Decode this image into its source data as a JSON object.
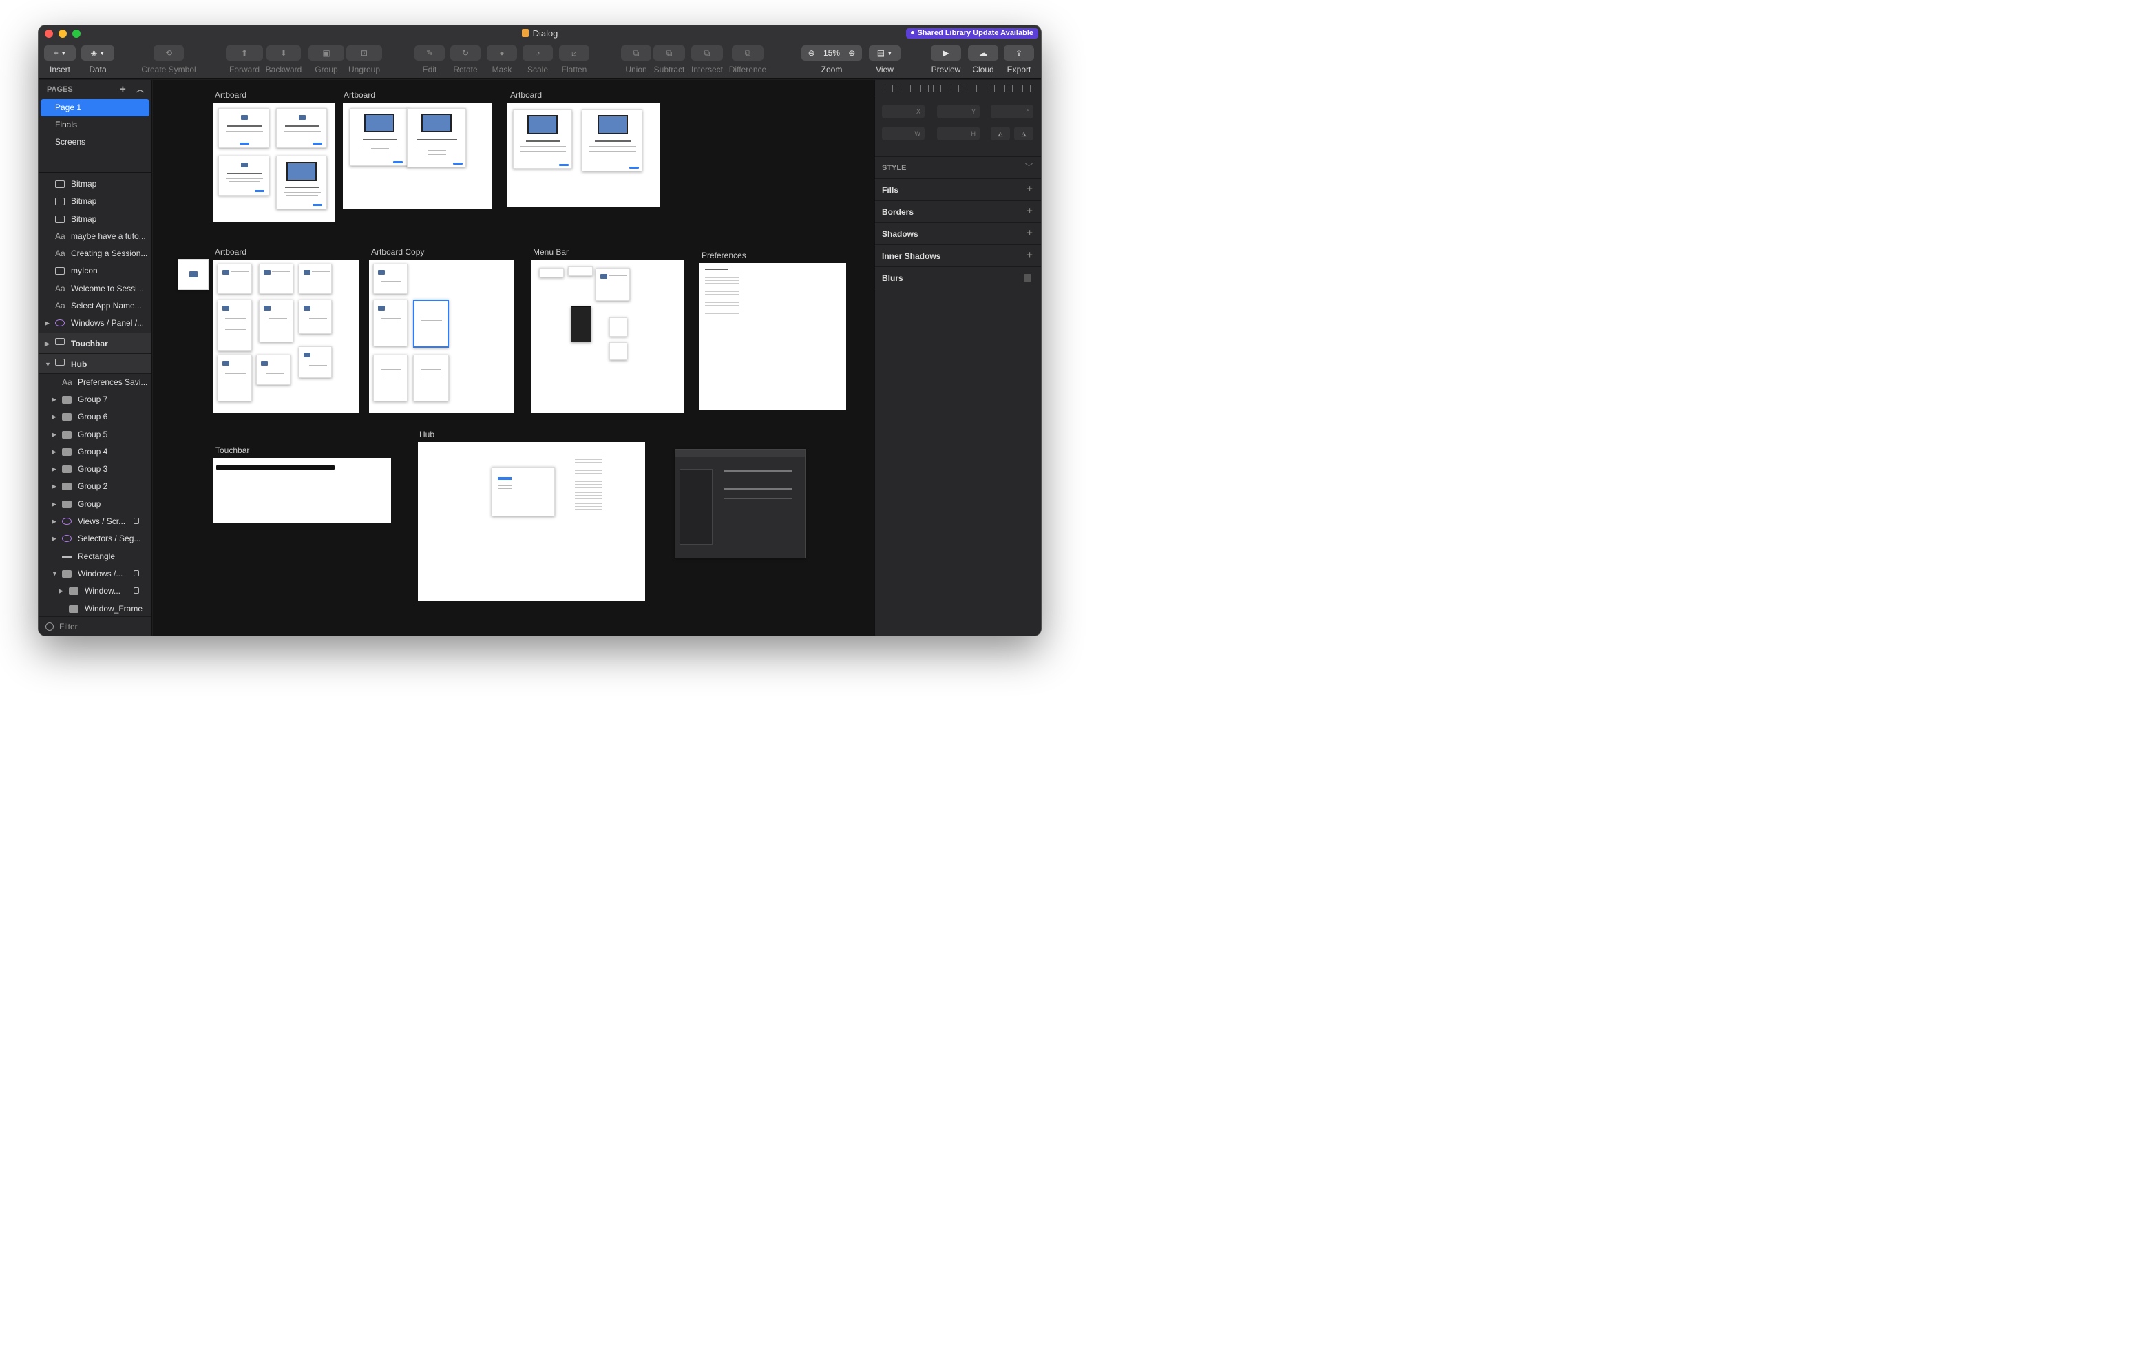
{
  "window": {
    "title": "Dialog",
    "notification": "Shared Library Update Available"
  },
  "toolbar": {
    "insert": "Insert",
    "data": "Data",
    "create_symbol": "Create Symbol",
    "forward": "Forward",
    "backward": "Backward",
    "group": "Group",
    "ungroup": "Ungroup",
    "edit": "Edit",
    "rotate": "Rotate",
    "mask": "Mask",
    "scale": "Scale",
    "flatten": "Flatten",
    "union": "Union",
    "subtract": "Subtract",
    "intersect": "Intersect",
    "difference": "Difference",
    "zoom_label": "Zoom",
    "zoom_value": "15%",
    "view": "View",
    "preview": "Preview",
    "cloud": "Cloud",
    "export": "Export"
  },
  "pages": {
    "header": "PAGES",
    "items": [
      "Page 1",
      "Finals",
      "Screens"
    ],
    "selected": "Page 1"
  },
  "layers": [
    {
      "label": "Bitmap",
      "icon": "image-icon",
      "level": 0
    },
    {
      "label": "Bitmap",
      "icon": "image-icon",
      "level": 0
    },
    {
      "label": "Bitmap",
      "icon": "image-icon",
      "level": 0
    },
    {
      "label": "maybe have a tuto...",
      "icon": "text-icon",
      "level": 0
    },
    {
      "label": "Creating a Session...",
      "icon": "text-icon",
      "level": 0
    },
    {
      "label": "myIcon",
      "icon": "image-icon",
      "level": 0
    },
    {
      "label": "Welcome to Sessi...",
      "icon": "text-icon",
      "level": 0
    },
    {
      "label": "Select App Name...",
      "icon": "text-icon",
      "level": 0
    },
    {
      "label": "Windows / Panel /...",
      "icon": "symbol-icon",
      "level": 0,
      "expandable": true
    }
  ],
  "artboard_groups": [
    {
      "label": "Touchbar",
      "expanded": false
    },
    {
      "label": "Hub",
      "expanded": true
    }
  ],
  "hub_layers": [
    {
      "label": "Preferences Savi...",
      "icon": "text-icon",
      "level": 1
    },
    {
      "label": "Group 7",
      "icon": "folder-icon",
      "level": 1,
      "expandable": true
    },
    {
      "label": "Group 6",
      "icon": "folder-icon",
      "level": 1,
      "expandable": true
    },
    {
      "label": "Group 5",
      "icon": "folder-icon",
      "level": 1,
      "expandable": true
    },
    {
      "label": "Group 4",
      "icon": "folder-icon",
      "level": 1,
      "expandable": true
    },
    {
      "label": "Group 3",
      "icon": "folder-icon",
      "level": 1,
      "expandable": true
    },
    {
      "label": "Group 2",
      "icon": "folder-icon",
      "level": 1,
      "expandable": true
    },
    {
      "label": "Group",
      "icon": "folder-icon",
      "level": 1,
      "expandable": true
    },
    {
      "label": "Views / Scr...",
      "icon": "symbol-icon",
      "level": 1,
      "expandable": true,
      "locked": true
    },
    {
      "label": "Selectors / Seg...",
      "icon": "symbol-icon",
      "level": 1,
      "expandable": true
    },
    {
      "label": "Rectangle",
      "icon": "rectangle-icon",
      "level": 1
    },
    {
      "label": "Windows /...",
      "icon": "folder-icon",
      "level": 1,
      "expandable": true,
      "expanded": true,
      "locked": true
    },
    {
      "label": "Window...",
      "icon": "folder-icon",
      "level": 2,
      "expandable": true,
      "locked": true
    },
    {
      "label": "Window_Frame",
      "icon": "folder-icon",
      "level": 2
    }
  ],
  "filter": {
    "placeholder": "Filter"
  },
  "canvas": {
    "artboards": [
      {
        "label": "Artboard"
      },
      {
        "label": "Artboard"
      },
      {
        "label": "Artboard"
      },
      {
        "label": "Artboard"
      },
      {
        "label": "Artboard Copy"
      },
      {
        "label": "Menu Bar"
      },
      {
        "label": "Preferences"
      },
      {
        "label": "Touchbar"
      },
      {
        "label": "Hub"
      }
    ]
  },
  "inspector": {
    "fields": {
      "x": "X",
      "y": "Y",
      "rotation": "°",
      "w": "W",
      "h": "H"
    },
    "style_header": "STYLE",
    "sections": [
      "Fills",
      "Borders",
      "Shadows",
      "Inner Shadows",
      "Blurs"
    ]
  },
  "colors": {
    "accent": "#2e7cf6",
    "notification": "#5b3fd6",
    "symbol": "#b07ce8"
  }
}
